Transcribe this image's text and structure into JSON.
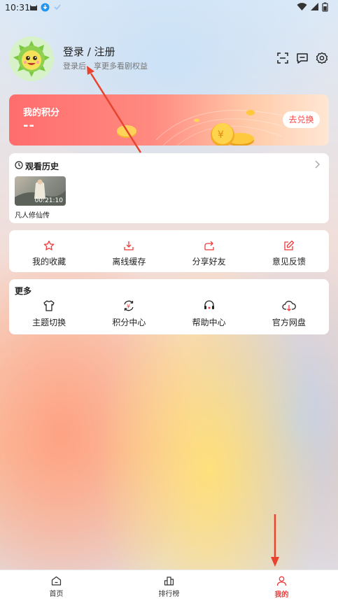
{
  "status_bar": {
    "time": "10:31"
  },
  "header": {
    "login_title": "登录 / 注册",
    "login_subtitle": "登录后，享更多看剧权益",
    "icons": [
      "scan-icon",
      "message-icon",
      "settings-icon"
    ]
  },
  "points_card": {
    "title": "我的积分",
    "value": "--",
    "redeem_label": "去兑换"
  },
  "history": {
    "title": "观看历史",
    "items": [
      {
        "title": "凡人修仙传",
        "time": "00:21:10"
      }
    ]
  },
  "actions": [
    {
      "label": "我的收藏",
      "icon": "star-icon"
    },
    {
      "label": "离线缓存",
      "icon": "download-icon"
    },
    {
      "label": "分享好友",
      "icon": "share-icon"
    },
    {
      "label": "意见反馈",
      "icon": "feedback-icon"
    }
  ],
  "more": {
    "title": "更多",
    "items": [
      {
        "label": "主题切换",
        "icon": "tshirt-icon"
      },
      {
        "label": "积分中心",
        "icon": "yuan-cycle-icon"
      },
      {
        "label": "帮助中心",
        "icon": "headset-icon"
      },
      {
        "label": "官方网盘",
        "icon": "cloud-download-icon"
      }
    ]
  },
  "bottom_nav": [
    {
      "label": "首页",
      "icon": "home-icon",
      "active": false
    },
    {
      "label": "排行榜",
      "icon": "ranking-icon",
      "active": false
    },
    {
      "label": "我的",
      "icon": "user-icon",
      "active": true
    }
  ],
  "colors": {
    "accent": "#ee3b3b",
    "points_gradient_start": "#ff6d6d"
  }
}
